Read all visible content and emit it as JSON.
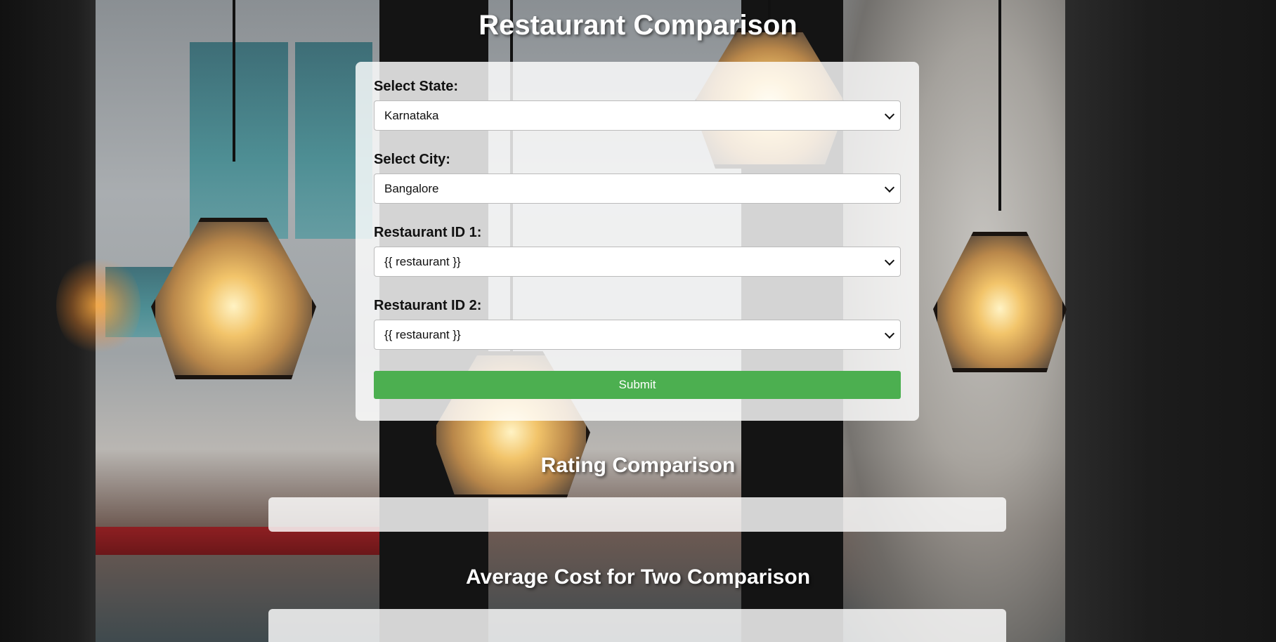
{
  "page": {
    "title": "Restaurant Comparison"
  },
  "form": {
    "state": {
      "label": "Select State:",
      "value": "Karnataka"
    },
    "city": {
      "label": "Select City:",
      "value": "Bangalore"
    },
    "restaurant1": {
      "label": "Restaurant ID 1:",
      "value": "{{ restaurant }}"
    },
    "restaurant2": {
      "label": "Restaurant ID 2:",
      "value": "{{ restaurant }}"
    },
    "submit_label": "Submit"
  },
  "sections": {
    "rating_title": "Rating Comparison",
    "cost_title": "Average Cost for Two Comparison"
  },
  "colors": {
    "submit": "#4caf50",
    "card": "rgba(255,255,255,0.82)"
  }
}
